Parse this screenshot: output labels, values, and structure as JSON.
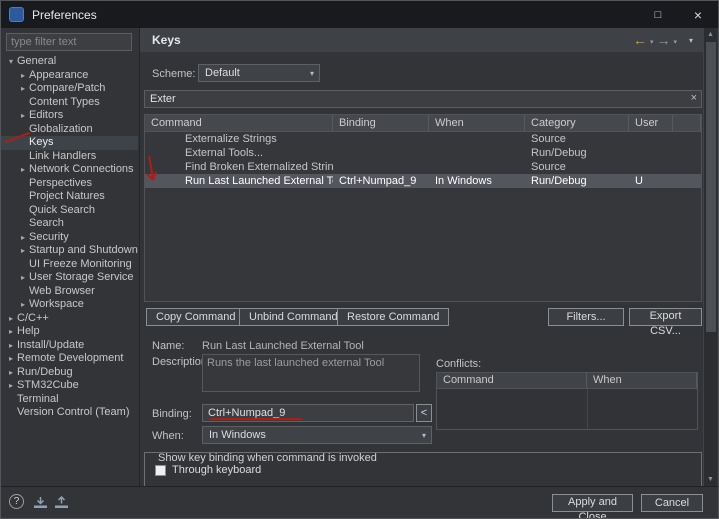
{
  "window": {
    "title": "Preferences"
  },
  "icons": {
    "maximize": "□",
    "close": "×",
    "clear": "×",
    "back": "←",
    "forward": "→",
    "caret": "▾",
    "menu": "▾",
    "up": "▲",
    "down": "▼",
    "left_small": "<",
    "help": "?",
    "exp_collapsed": "▸",
    "exp_expanded": "▾"
  },
  "annotation_color": "#b51b15",
  "sidebar": {
    "filter_placeholder": "type filter text",
    "tree": [
      {
        "label": "General",
        "level": 0,
        "expander": "expanded"
      },
      {
        "label": "Appearance",
        "level": 1,
        "expander": "collapsed"
      },
      {
        "label": "Compare/Patch",
        "level": 1,
        "expander": "collapsed"
      },
      {
        "label": "Content Types",
        "level": 1,
        "expander": "none"
      },
      {
        "label": "Editors",
        "level": 1,
        "expander": "collapsed"
      },
      {
        "label": "Globalization",
        "level": 1,
        "expander": "none"
      },
      {
        "label": "Keys",
        "level": 1,
        "expander": "none",
        "selected": true
      },
      {
        "label": "Link Handlers",
        "level": 1,
        "expander": "none"
      },
      {
        "label": "Network Connections",
        "level": 1,
        "expander": "collapsed"
      },
      {
        "label": "Perspectives",
        "level": 1,
        "expander": "none"
      },
      {
        "label": "Project Natures",
        "level": 1,
        "expander": "none"
      },
      {
        "label": "Quick Search",
        "level": 1,
        "expander": "none"
      },
      {
        "label": "Search",
        "level": 1,
        "expander": "none"
      },
      {
        "label": "Security",
        "level": 1,
        "expander": "collapsed"
      },
      {
        "label": "Startup and Shutdown",
        "level": 1,
        "expander": "collapsed"
      },
      {
        "label": "UI Freeze Monitoring",
        "level": 1,
        "expander": "none"
      },
      {
        "label": "User Storage Service",
        "level": 1,
        "expander": "collapsed"
      },
      {
        "label": "Web Browser",
        "level": 1,
        "expander": "none"
      },
      {
        "label": "Workspace",
        "level": 1,
        "expander": "collapsed"
      },
      {
        "label": "C/C++",
        "level": 0,
        "expander": "collapsed"
      },
      {
        "label": "Help",
        "level": 0,
        "expander": "collapsed"
      },
      {
        "label": "Install/Update",
        "level": 0,
        "expander": "collapsed"
      },
      {
        "label": "Remote Development",
        "level": 0,
        "expander": "collapsed"
      },
      {
        "label": "Run/Debug",
        "level": 0,
        "expander": "collapsed"
      },
      {
        "label": "STM32Cube",
        "level": 0,
        "expander": "collapsed"
      },
      {
        "label": "Terminal",
        "level": 0,
        "expander": "none"
      },
      {
        "label": "Version Control (Team)",
        "level": 0,
        "expander": "collapsed"
      }
    ]
  },
  "main": {
    "title": "Keys",
    "scheme_label": "Scheme:",
    "scheme_value": "Default",
    "filter_value": "Exter",
    "table": {
      "columns": [
        "Command",
        "Binding",
        "When",
        "Category",
        "User"
      ],
      "rows": [
        {
          "command": "Externalize Strings",
          "binding": "",
          "when": "",
          "category": "Source",
          "user": ""
        },
        {
          "command": "External Tools...",
          "binding": "",
          "when": "",
          "category": "Run/Debug",
          "user": ""
        },
        {
          "command": "Find Broken Externalized Strings",
          "binding": "",
          "when": "",
          "category": "Source",
          "user": ""
        },
        {
          "command": "Run Last Launched External Tool",
          "binding": "Ctrl+Numpad_9",
          "when": "In Windows",
          "category": "Run/Debug",
          "user": "U"
        }
      ]
    },
    "buttons": {
      "copy": "Copy Command",
      "unbind": "Unbind Command",
      "restore": "Restore Command",
      "filters": "Filters...",
      "export": "Export CSV..."
    },
    "detail": {
      "name_label": "Name:",
      "name_value": "Run Last Launched External Tool",
      "description_label": "Description:",
      "description_value": "Runs the last launched external Tool",
      "conflicts_label": "Conflicts:",
      "conflicts_columns": [
        "Command",
        "When"
      ],
      "binding_label": "Binding:",
      "binding_value": "Ctrl+Numpad_9",
      "when_label": "When:",
      "when_value": "In Windows"
    },
    "group": {
      "title": "Show key binding when command is invoked",
      "checkbox": "Through keyboard"
    }
  },
  "footer": {
    "apply": "Apply and Close",
    "cancel": "Cancel"
  }
}
